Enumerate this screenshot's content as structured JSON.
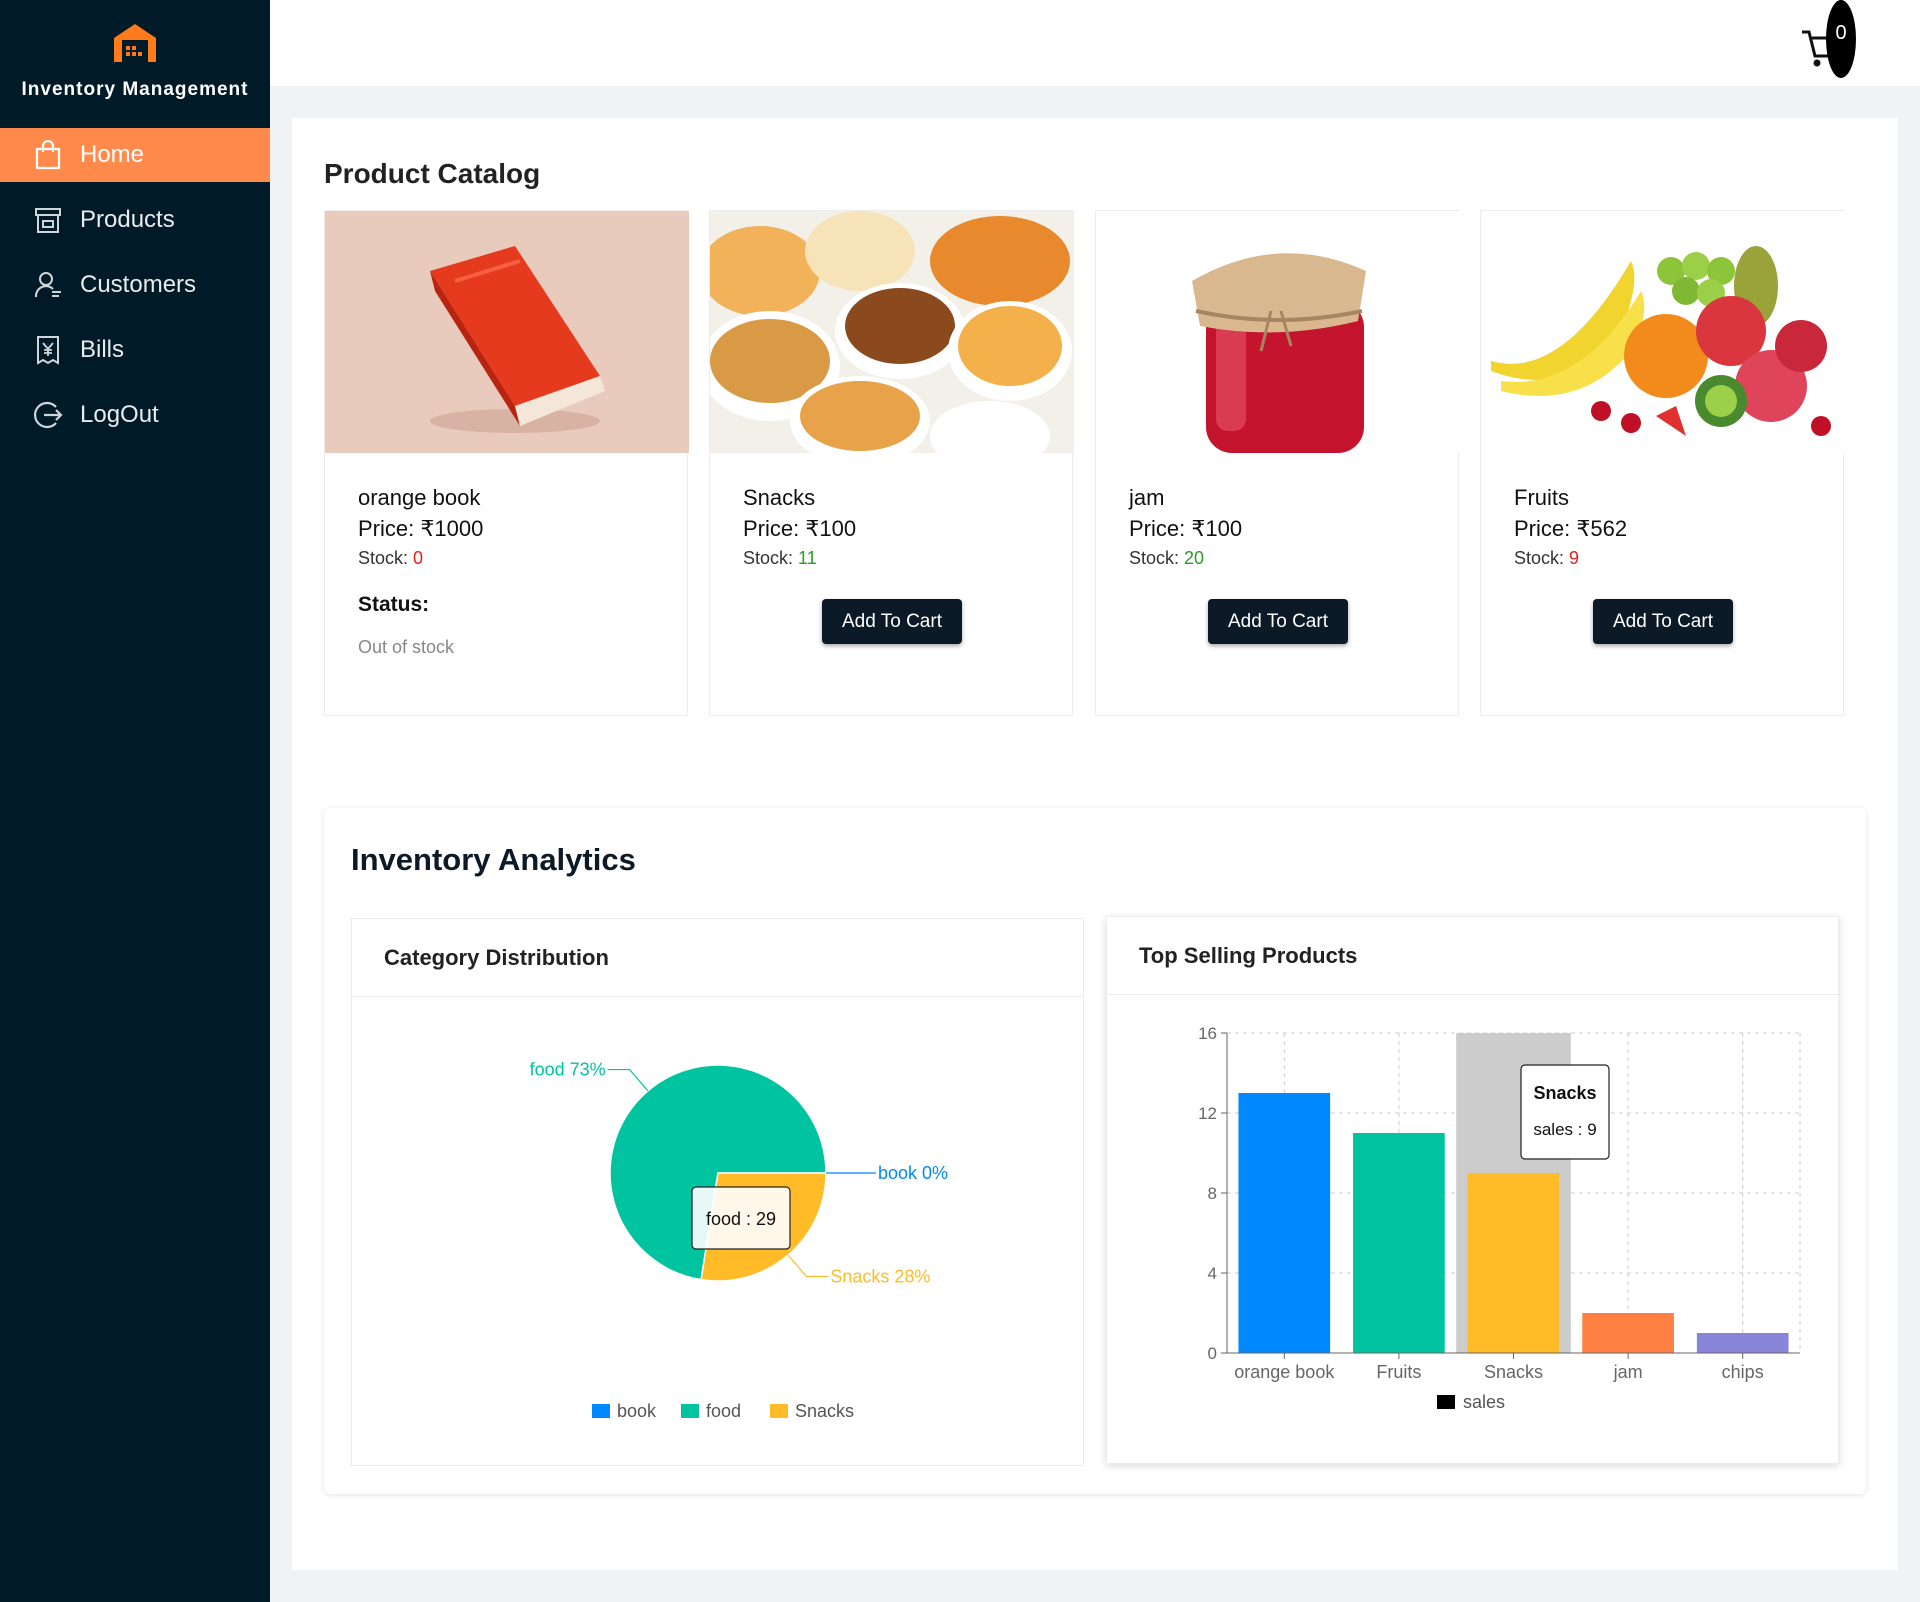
{
  "app": {
    "title": "Inventory Management"
  },
  "sidebar": {
    "items": [
      {
        "label": "Home",
        "icon": "bag-icon",
        "active": true
      },
      {
        "label": "Products",
        "icon": "store-icon",
        "active": false
      },
      {
        "label": "Customers",
        "icon": "user-icon",
        "active": false
      },
      {
        "label": "Bills",
        "icon": "receipt-icon",
        "active": false
      },
      {
        "label": "LogOut",
        "icon": "logout-icon",
        "active": false
      }
    ]
  },
  "header": {
    "cart_count": "0"
  },
  "catalog": {
    "title": "Product Catalog",
    "price_prefix": "Price: ₹",
    "stock_prefix": "Stock: ",
    "add_label": "Add To Cart",
    "status_label": "Status:",
    "products": [
      {
        "name": "orange book",
        "price": "1000",
        "stock": "0",
        "status": "Out of stock",
        "image": "red-book"
      },
      {
        "name": "Snacks",
        "price": "100",
        "stock": "11",
        "image": "snack-bowls"
      },
      {
        "name": "jam",
        "price": "100",
        "stock": "20",
        "image": "jam-jar"
      },
      {
        "name": "Fruits",
        "price": "562",
        "stock": "9",
        "image": "fruit-pile"
      }
    ]
  },
  "analytics": {
    "title": "Inventory Analytics",
    "category_title": "Category Distribution",
    "top_title": "Top Selling Products"
  },
  "colors": {
    "accent": "#ff8a4c",
    "sidebar": "#001a28",
    "book": "#0088fe",
    "food": "#00c49f",
    "snacks": "#ffbb28",
    "jam": "#ff8042",
    "chips": "#8884d8"
  },
  "chart_data": [
    {
      "type": "pie",
      "title": "Category Distribution",
      "categories": [
        "book",
        "food",
        "Snacks"
      ],
      "values": [
        0,
        29,
        11
      ],
      "labels": [
        "book 0%",
        "food 73%",
        "Snacks 28%"
      ],
      "legend": [
        "book",
        "food",
        "Snacks"
      ],
      "tooltip": "food : 29"
    },
    {
      "type": "bar",
      "title": "Top Selling Products",
      "categories": [
        "orange book",
        "Fruits",
        "Snacks",
        "jam",
        "chips"
      ],
      "series": [
        {
          "name": "sales",
          "values": [
            13,
            11,
            9,
            2,
            1
          ]
        }
      ],
      "yticks": [
        "0",
        "4",
        "8",
        "12",
        "16"
      ],
      "ylim": [
        0,
        16
      ],
      "grid": true,
      "legend": [
        "sales"
      ],
      "tooltip_title": "Snacks",
      "tooltip_value": "sales : 9"
    }
  ]
}
